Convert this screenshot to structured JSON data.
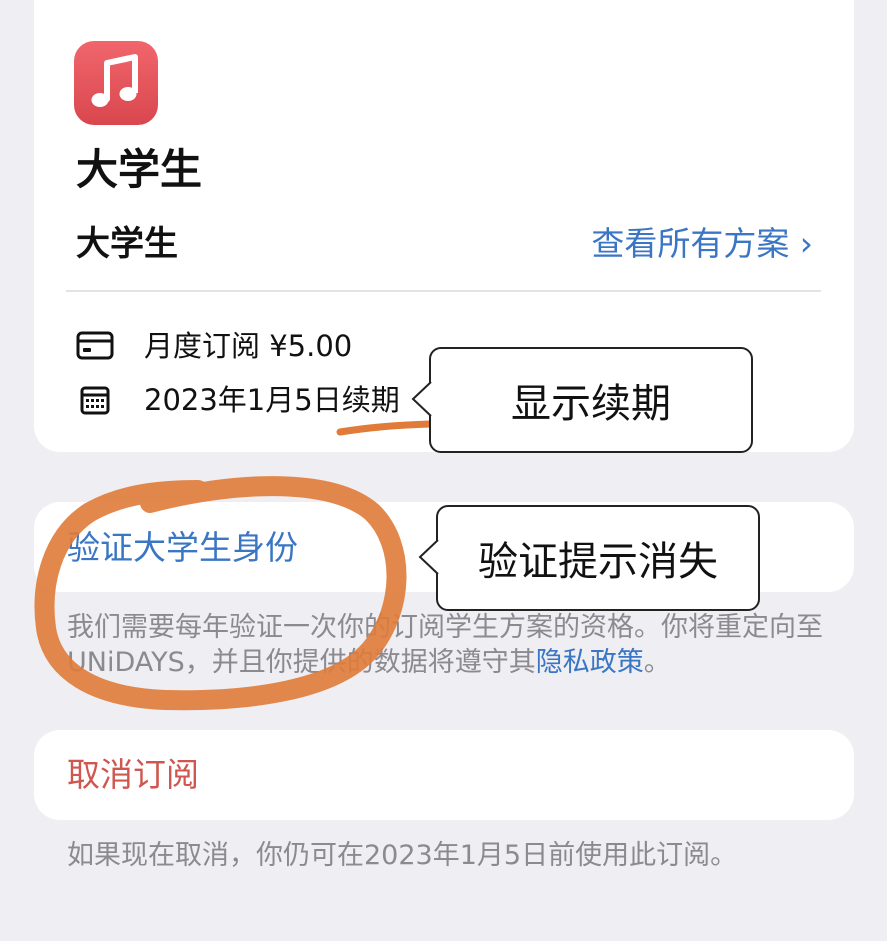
{
  "subscription": {
    "title": "大学生",
    "plan_name": "大学生",
    "view_all_label": "查看所有方案 ›",
    "price_text": "月度订阅 ¥5.00",
    "renewal_text": "2023年1月5日续期",
    "icons": {
      "app": "music-note-icon",
      "billing": "credit-card-icon",
      "renewal": "calendar-icon"
    }
  },
  "verification": {
    "link_label": "验证大学生身份",
    "footnote_line1": "我们需要每年验证一次你的订阅学生方案的资格。你将重定向至",
    "footnote_line2_prefix": "UNiDAYS，并且你提供的数据将遵守其",
    "privacy_link_label": "隐私政策",
    "footnote_line2_suffix": "。"
  },
  "cancel": {
    "button_label": "取消订阅",
    "footnote": "如果现在取消，你仍可在2023年1月5日前使用此订阅。"
  },
  "annotations": {
    "callout_renewal": "显示续期",
    "callout_verify": "验证提示消失"
  },
  "colors": {
    "background": "#efeef3",
    "card": "#ffffff",
    "link_blue": "#3a76c3",
    "destructive_red": "#d0574f",
    "secondary_gray": "#8a8a90",
    "app_icon_red": "#e2575d",
    "annotation_orange": "#e07b39"
  }
}
